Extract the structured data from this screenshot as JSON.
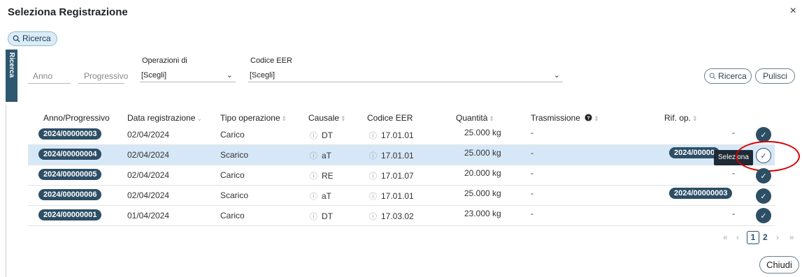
{
  "dialog": {
    "title": "Seleziona Registrazione",
    "close_glyph": "×"
  },
  "search_toggle": {
    "label": "Ricerca"
  },
  "side_tab": {
    "label": "Ricerca"
  },
  "filters": {
    "anno_placeholder": "Anno",
    "progressivo_placeholder": "Progressivo",
    "operazioni_label": "Operazioni di",
    "operazioni_value": "[Scegli]",
    "codice_eer_label": "Codice EER",
    "codice_eer_value": "[Scegli]",
    "search_button": "Ricerca",
    "clear_button": "Pulisci"
  },
  "table": {
    "headers": {
      "anno": "Anno/Progressivo",
      "data": "Data registrazione",
      "tipo": "Tipo operazione",
      "causale": "Causale",
      "eer": "Codice EER",
      "quantita": "Quantità",
      "trasmissione": "Trasmissione",
      "rif": "Rif. op."
    },
    "rows": [
      {
        "anno": "2024/00000003",
        "data": "02/04/2024",
        "tipo": "Carico",
        "causale": "DT",
        "eer": "17.01.01",
        "quantita": "25.000 kg",
        "trasmissione": "-",
        "rif": "-"
      },
      {
        "anno": "2024/00000004",
        "data": "02/04/2024",
        "tipo": "Scarico",
        "causale": "aT",
        "eer": "17.01.01",
        "quantita": "25.000 kg",
        "trasmissione": "-",
        "rif": "2024/00000"
      },
      {
        "anno": "2024/00000005",
        "data": "02/04/2024",
        "tipo": "Carico",
        "causale": "RE",
        "eer": "17.01.07",
        "quantita": "20.000 kg",
        "trasmissione": "-",
        "rif": "-"
      },
      {
        "anno": "2024/00000006",
        "data": "02/04/2024",
        "tipo": "Scarico",
        "causale": "aT",
        "eer": "17.01.01",
        "quantita": "25.000 kg",
        "trasmissione": "-",
        "rif": "2024/00000003"
      },
      {
        "anno": "2024/00000001",
        "data": "01/04/2024",
        "tipo": "Carico",
        "causale": "DT",
        "eer": "17.03.02",
        "quantita": "23.000 kg",
        "trasmissione": "-",
        "rif": "-"
      }
    ],
    "select_tooltip": "Seleziona"
  },
  "pagination": {
    "first": "«",
    "prev": "‹",
    "current": "1",
    "next_page": "2",
    "next": "›",
    "last": "»"
  },
  "footer": {
    "close_button": "Chiudi"
  },
  "colors": {
    "accent": "#2d4f66",
    "selected_row": "#d6e8f7",
    "highlight_ring": "#d60000"
  },
  "icons": [
    "search-icon",
    "close-icon",
    "chevron-down-icon",
    "info-icon",
    "question-icon",
    "check-icon"
  ]
}
